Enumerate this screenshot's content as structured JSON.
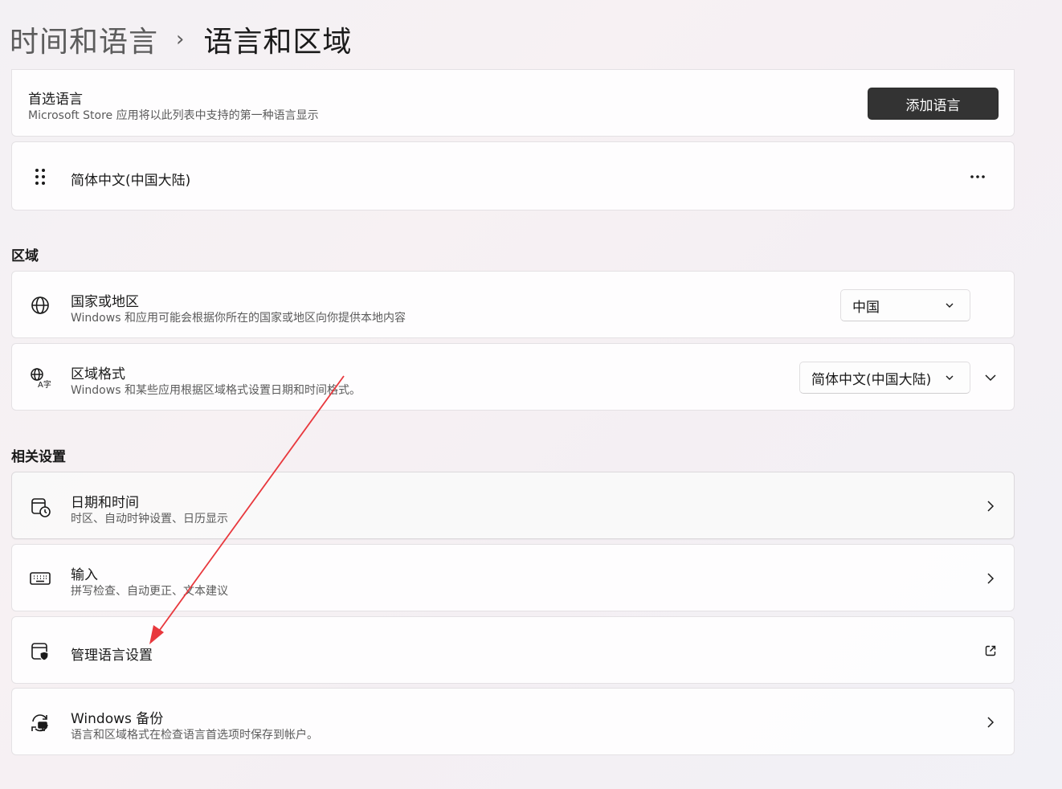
{
  "breadcrumb": {
    "parent": "时间和语言",
    "separator": "›",
    "current": "语言和区域"
  },
  "preferred_language": {
    "title": "首选语言",
    "desc": "Microsoft Store 应用将以此列表中支持的第一种语言显示",
    "add_button": "添加语言",
    "languages": [
      {
        "name": "简体中文(中国大陆)",
        "drag_icon": "drag-handle-icon",
        "more_icon": "more-icon"
      }
    ]
  },
  "region_section": {
    "heading": "区域",
    "country": {
      "title": "国家或地区",
      "desc": "Windows 和应用可能会根据你所在的国家或地区向你提供本地内容",
      "value": "中国",
      "icon": "globe-icon"
    },
    "format": {
      "title": "区域格式",
      "desc": "Windows 和某些应用根据区域格式设置日期和时间格式。",
      "value": "简体中文(中国大陆)",
      "icon": "language-format-icon"
    }
  },
  "related_section": {
    "heading": "相关设置",
    "items": [
      {
        "title": "日期和时间",
        "desc": "时区、自动时钟设置、日历显示",
        "icon": "calendar-clock-icon",
        "action_icon": "chevron-right-icon"
      },
      {
        "title": "输入",
        "desc": "拼写检查、自动更正、文本建议",
        "icon": "keyboard-icon",
        "action_icon": "chevron-right-icon"
      },
      {
        "title": "管理语言设置",
        "desc": "",
        "icon": "window-shield-icon",
        "action_icon": "open-external-icon"
      },
      {
        "title": "Windows 备份",
        "desc": "语言和区域格式在检查语言首选项时保存到帐户。",
        "icon": "backup-sync-icon",
        "action_icon": "chevron-right-icon"
      }
    ]
  },
  "annotation": {
    "arrow_color": "#e8383d",
    "arrow_icon": "red-arrow-annotation"
  },
  "colors": {
    "primary_button_bg": "#333333",
    "primary_button_text": "#ffffff",
    "card_bg": "#ffffff",
    "secondary_text": "#5b5b5b"
  }
}
